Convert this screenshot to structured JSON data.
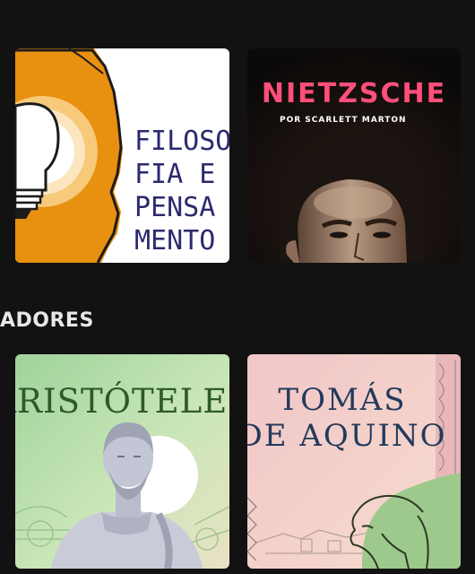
{
  "section": {
    "title": "ADORES"
  },
  "cards": [
    {
      "id": "filosofia",
      "title_lines": [
        "FILOSO",
        "FIA E",
        "PENSA",
        "MENTO"
      ]
    },
    {
      "id": "nietzsche",
      "title": "NIETZSCHE",
      "author": "POR SCARLETT MARTON"
    },
    {
      "id": "aristoteles",
      "title": "ARISTÓTELES"
    },
    {
      "id": "tomas",
      "title_lines": [
        "TOMÁS",
        "DE AQUINO"
      ]
    }
  ],
  "colors": {
    "background": "#121212",
    "orange": "#e8900f",
    "nietzsche_pink": "#ff4f7a",
    "aristoteles_green": "#2e5a2a",
    "tomas_navy": "#223a5c"
  }
}
